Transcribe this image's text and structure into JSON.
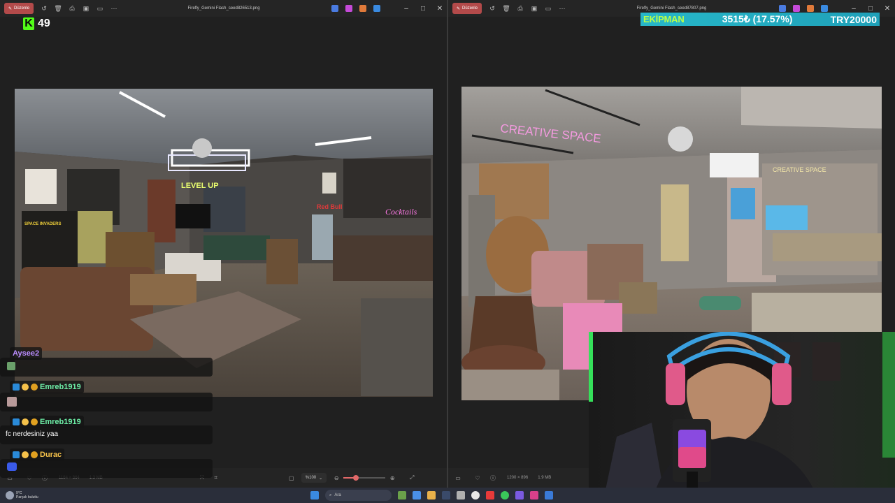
{
  "left_window": {
    "badge": "Düzenle",
    "filename": "Firefly_Gemini Flash_seed826513.png",
    "status": {
      "dimensions": "1184 × 864",
      "filesize": "1.3 MB",
      "zoom": "%100"
    }
  },
  "right_window": {
    "badge": "Düzenle",
    "filename": "Firefly_Gemini Flash_seed87807.png",
    "status": {
      "dimensions": "1200 × 896",
      "filesize": "1.9 MB"
    }
  },
  "kick": {
    "viewers": "49",
    "accent": "#53fc18"
  },
  "ticker": {
    "name": "EKİPMAN",
    "value": "3515₺ (17.57%)",
    "target": "TRY20000"
  },
  "chat": [
    {
      "user": "Aysee2",
      "color": "#b98cff",
      "text": ""
    },
    {
      "user": "Emreb1919",
      "color": "#6ef0a8",
      "text": ""
    },
    {
      "user": "Emreb1919",
      "color": "#6ef0a8",
      "text": "fc nerdesiniz yaa"
    },
    {
      "user": "Durac",
      "color": "#f5c14a",
      "text": ""
    }
  ],
  "taskbar": {
    "weather_temp": "9°C",
    "weather_desc": "Parçalı bulutlu",
    "search_placeholder": "Ara"
  },
  "photo_labels": {
    "left_neon_1": "LEVEL UP",
    "left_neon_2": "Cocktails",
    "left_can": "Red Bull",
    "left_poster": "SPACE INVADERS",
    "right_neon": "CREATIVE SPACE",
    "right_neon_2": "CREATIVE SPACE"
  }
}
